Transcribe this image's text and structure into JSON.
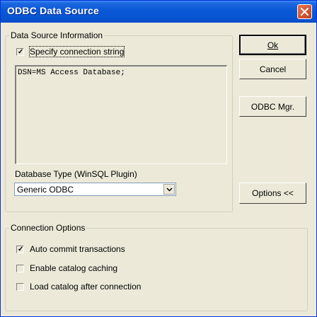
{
  "window": {
    "title": "ODBC Data Source",
    "close_label": "close"
  },
  "data_source_group": {
    "legend": "Data Source Information",
    "specify_checkbox": {
      "label": "Specify connection string",
      "checked": true
    },
    "connection_string": "DSN=MS Access Database;",
    "db_type_label": "Database Type (WinSQL Plugin)",
    "db_type_value": "Generic ODBC"
  },
  "buttons": {
    "ok": "Ok",
    "cancel": "Cancel",
    "odbc_mgr": "ODBC Mgr.",
    "options": "Options <<"
  },
  "connection_options_group": {
    "legend": "Connection Options",
    "options": [
      {
        "label": "Auto commit transactions",
        "checked": true
      },
      {
        "label": "Enable catalog caching",
        "checked": false
      },
      {
        "label": "Load catalog after connection",
        "checked": false
      }
    ]
  },
  "colors": {
    "title_bar": "#0a58d6",
    "dialog_bg": "#ece9d8",
    "close_button": "#d9552e"
  }
}
